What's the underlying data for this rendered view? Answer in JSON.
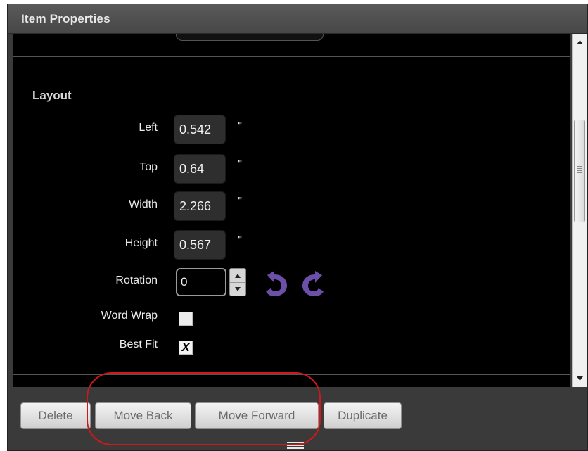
{
  "window": {
    "title": "Item Properties"
  },
  "layout_section": {
    "title": "Layout",
    "unit": "\"",
    "fields": [
      {
        "label": "Left",
        "value": "0.542"
      },
      {
        "label": "Top",
        "value": "0.64"
      },
      {
        "label": "Width",
        "value": "2.266"
      },
      {
        "label": "Height",
        "value": "0.567"
      }
    ],
    "rotation": {
      "label": "Rotation",
      "value": "0",
      "rotate_left_icon": "rotate-counterclockwise-icon",
      "rotate_right_icon": "rotate-clockwise-icon"
    },
    "word_wrap": {
      "label": "Word Wrap",
      "checked": false
    },
    "best_fit": {
      "label": "Best Fit",
      "checked": true,
      "mark": "X"
    }
  },
  "buttons": {
    "delete": "Delete",
    "move_back": "Move Back",
    "move_forward": "Move Forward",
    "duplicate": "Duplicate"
  },
  "colors": {
    "accent_icon": "#6b4fa8",
    "highlight": "#d01818",
    "panel_bg": "#000000"
  }
}
